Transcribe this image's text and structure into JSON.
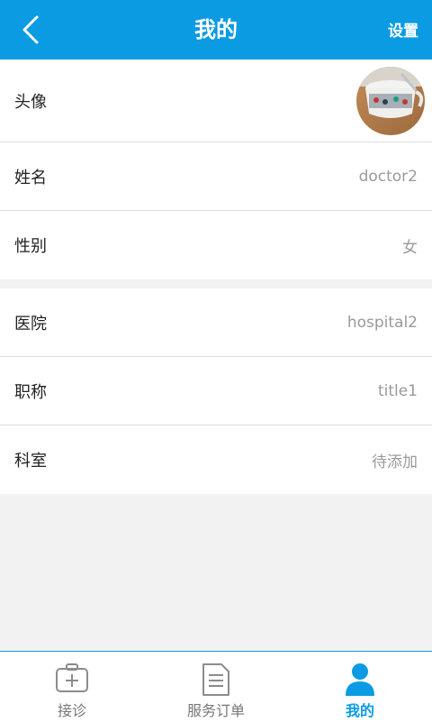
{
  "header": {
    "title": "我的",
    "settings_label": "设置"
  },
  "profile": {
    "avatar_label": "头像",
    "name": {
      "label": "姓名",
      "value": "doctor2"
    },
    "gender": {
      "label": "性别",
      "value": "女"
    }
  },
  "work": {
    "hospital": {
      "label": "医院",
      "value": "hospital2"
    },
    "title": {
      "label": "职称",
      "value": "title1"
    },
    "department": {
      "label": "科室",
      "value": "待添加"
    }
  },
  "tabs": [
    {
      "label": "接诊",
      "icon": "medical-kit-icon",
      "active": false
    },
    {
      "label": "服务订单",
      "icon": "document-icon",
      "active": false
    },
    {
      "label": "我的",
      "icon": "person-icon",
      "active": true
    }
  ],
  "colors": {
    "accent": "#0a9be2",
    "background": "#f2f2f2",
    "value_text": "#9a9a9a"
  }
}
